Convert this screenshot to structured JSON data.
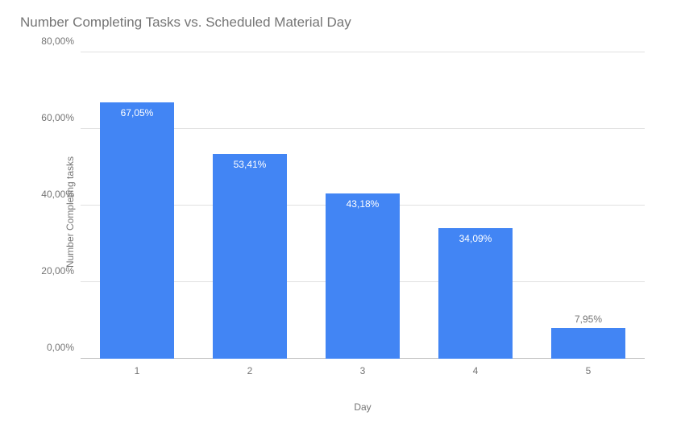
{
  "chart_data": {
    "type": "bar",
    "title": "Number Completing Tasks vs. Scheduled Material Day",
    "xlabel": "Day",
    "ylabel": "Number Completing tasks",
    "categories": [
      "1",
      "2",
      "3",
      "4",
      "5"
    ],
    "values": [
      67.05,
      53.41,
      43.18,
      34.09,
      7.95
    ],
    "value_labels": [
      "67,05%",
      "53,41%",
      "43,18%",
      "34,09%",
      "7,95%"
    ],
    "y_ticks": [
      "0,00%",
      "20,00%",
      "40,00%",
      "60,00%",
      "80,00%"
    ],
    "ylim": [
      0,
      80
    ],
    "bar_color": "#4285f4"
  }
}
